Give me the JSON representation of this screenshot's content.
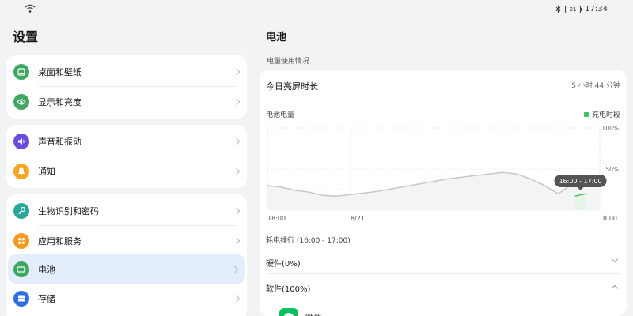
{
  "status_bar": {
    "time": "17:34",
    "battery": "21",
    "icons": [
      "wifi-icon",
      "bluetooth-icon",
      "battery-icon"
    ]
  },
  "sidebar": {
    "title": "设置",
    "groups": [
      {
        "items": [
          {
            "label": "桌面和壁纸",
            "icon": "wallpaper-icon",
            "color": "#3ea863"
          },
          {
            "label": "显示和亮度",
            "icon": "eye-icon",
            "color": "#3ea863"
          }
        ]
      },
      {
        "items": [
          {
            "label": "声音和振动",
            "icon": "sound-icon",
            "color": "#6c4ce0"
          },
          {
            "label": "通知",
            "icon": "bell-icon",
            "color": "#f5a623"
          }
        ]
      },
      {
        "items": [
          {
            "label": "生物识别和密码",
            "icon": "key-icon",
            "color": "#2ba69a"
          },
          {
            "label": "应用和服务",
            "icon": "apps-icon",
            "color": "#f29a1f"
          },
          {
            "label": "电池",
            "icon": "battery-icon",
            "color": "#3ea863",
            "selected": true
          },
          {
            "label": "存储",
            "icon": "storage-icon",
            "color": "#2f6fe3"
          }
        ]
      }
    ]
  },
  "main": {
    "title": "电池",
    "section_label": "电量使用情况",
    "screen_time": {
      "label": "今日亮屏时长",
      "value": "5 小时 44 分钟"
    },
    "chart_title": "电池电量",
    "legend_label": "充电时段",
    "tooltip": "16:00 - 17:00",
    "ranking_label": "耗电排行 (16:00 - 17:00)",
    "rows": [
      {
        "label": "硬件(0%)",
        "state": "collapsed"
      },
      {
        "label": "软件(100%)",
        "state": "expanded"
      }
    ],
    "app": {
      "name": "微信",
      "icon": "wechat-icon",
      "color": "#07c160"
    }
  },
  "chart_data": {
    "type": "area",
    "title": "电池电量",
    "x_tick_labels": [
      "18:00",
      "8/21",
      "18:00"
    ],
    "y_tick_labels": [
      "100%",
      "50%"
    ],
    "ylim": [
      0,
      100
    ],
    "xlim": [
      0,
      24
    ],
    "x": [
      0,
      1,
      2,
      3,
      4,
      5,
      6,
      7,
      8,
      9,
      10,
      11,
      12,
      13,
      14,
      15,
      16,
      17,
      18,
      19,
      20,
      21,
      22,
      23,
      24
    ],
    "series": [
      {
        "values": [
          30,
          28,
          24,
          22,
          18,
          17,
          19,
          21,
          23,
          26,
          29,
          32,
          35,
          38,
          40,
          42,
          44,
          46,
          44,
          38,
          30,
          20,
          32,
          33,
          29
        ]
      }
    ],
    "charging_segment": {
      "x": [
        22.2,
        23.0
      ],
      "values": [
        17,
        20
      ]
    },
    "highlight_range_label": "16:00 - 17:00",
    "legend": [
      {
        "name": "充电时段",
        "color": "#3fbf5f"
      }
    ],
    "line_color": "#c8c8c8",
    "grid": true
  }
}
